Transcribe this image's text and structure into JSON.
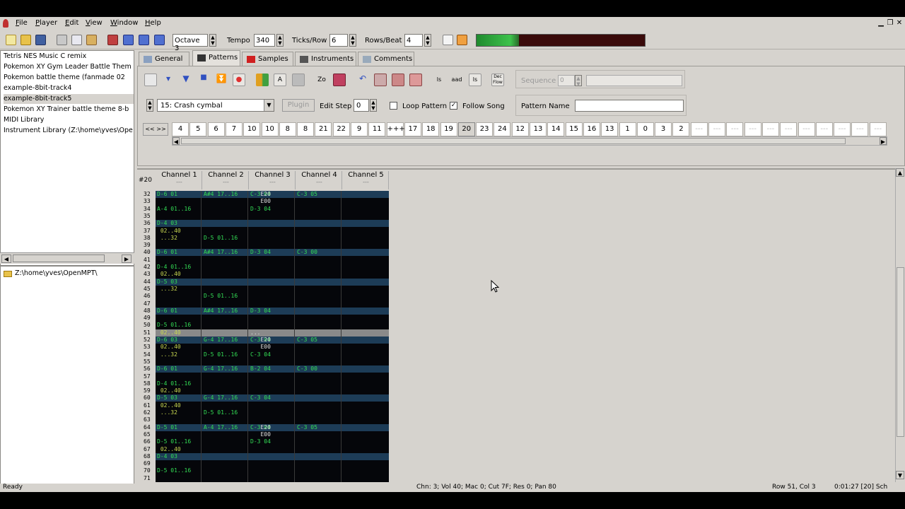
{
  "menubar": {
    "items": [
      "File",
      "Player",
      "Edit",
      "View",
      "Window",
      "Help"
    ],
    "underline": [
      "F",
      "P",
      "E",
      "V",
      "W",
      "H"
    ]
  },
  "toolbar": {
    "octave_label": "Octave 3",
    "tempo_label": "Tempo",
    "tempo_value": "340",
    "ticks_label": "Ticks/Row",
    "ticks_value": "6",
    "rows_label": "Rows/Beat",
    "rows_value": "4",
    "vu_level": 0.25
  },
  "tree": {
    "items": [
      "Tetris NES Music C remix",
      "Pokemon XY Gym Leader Battle Them",
      "Pokemon battle theme (fanmade 02",
      "example-8bit-track4",
      "example-8bit-track5",
      "Pokemon XY Trainer battle theme 8-b",
      "MIDI Library",
      "Instrument Library (Z:\\home\\yves\\Ope"
    ],
    "selected": 4
  },
  "folder": {
    "path": "Z:\\home\\yves\\OpenMPT\\"
  },
  "tabs": [
    "General",
    "Patterns",
    "Samples",
    "Instruments",
    "Comments"
  ],
  "active_tab": 1,
  "pattern_controls": {
    "instrument": "15: Crash cymbal",
    "plugin_label": "Plugin",
    "edit_step_label": "Edit Step",
    "edit_step_value": "0",
    "loop_pattern_label": "Loop Pattern",
    "loop_pattern_checked": false,
    "follow_song_label": "Follow Song",
    "follow_song_checked": true,
    "pattern_name_label": "Pattern Name",
    "sequence_label": "Sequence",
    "sequence_value": "0",
    "order_nav": "<< >>"
  },
  "orders": [
    "4",
    "5",
    "6",
    "7",
    "10",
    "10",
    "8",
    "8",
    "21",
    "22",
    "9",
    "11",
    "+++",
    "17",
    "18",
    "19",
    "20",
    "23",
    "24",
    "12",
    "13",
    "14",
    "15",
    "16",
    "13",
    "1",
    "0",
    "3",
    "2",
    "---",
    "---",
    "---",
    "---",
    "---",
    "---",
    "---",
    "---",
    "---",
    "---",
    "---"
  ],
  "current_order": 16,
  "pattern": {
    "number": "#20",
    "channels": [
      "Channel 1",
      "Channel 2",
      "Channel 3",
      "Channel 4",
      "Channel 5"
    ],
    "channel_dash": "---",
    "rows": [
      "32",
      "33",
      "34",
      "35",
      "36",
      "37",
      "38",
      "39",
      "40",
      "41",
      "42",
      "43",
      "44",
      "45",
      "46",
      "47",
      "48",
      "49",
      "50",
      "51",
      "52",
      "53",
      "54",
      "55",
      "56",
      "57",
      "58",
      "59",
      "60",
      "61",
      "62",
      "63",
      "64",
      "65",
      "66",
      "67",
      "68",
      "69",
      "70",
      "71"
    ],
    "current_row_index": 19,
    "beat_rows": [
      0,
      4,
      8,
      12,
      16,
      20,
      24,
      28,
      32,
      36
    ],
    "cells": [
      {
        "r": 0,
        "c": 0,
        "t": "D-6 01",
        "k": "g"
      },
      {
        "r": 0,
        "c": 1,
        "t": "A#4 17..16",
        "k": "g"
      },
      {
        "r": 0,
        "c": 2,
        "t": "C-3 04",
        "k": "g"
      },
      {
        "r": 0,
        "c": 2,
        "t": "   E20",
        "k": "w"
      },
      {
        "r": 0,
        "c": 3,
        "t": "C-3 05",
        "k": "g"
      },
      {
        "r": 1,
        "c": 2,
        "t": "   E00",
        "k": "w"
      },
      {
        "r": 2,
        "c": 0,
        "t": "A-4 01..16",
        "k": "g"
      },
      {
        "r": 2,
        "c": 2,
        "t": "D-3 04",
        "k": "g"
      },
      {
        "r": 4,
        "c": 0,
        "t": "D-4 03",
        "k": "g"
      },
      {
        "r": 5,
        "c": 0,
        "t": " 02..40",
        "k": "y"
      },
      {
        "r": 6,
        "c": 0,
        "t": " ...32",
        "k": "y"
      },
      {
        "r": 6,
        "c": 1,
        "t": "D-5 01..16",
        "k": "g"
      },
      {
        "r": 8,
        "c": 0,
        "t": "D-6 01",
        "k": "g"
      },
      {
        "r": 8,
        "c": 1,
        "t": "A#4 17..16",
        "k": "g"
      },
      {
        "r": 8,
        "c": 2,
        "t": "D-3 04",
        "k": "g"
      },
      {
        "r": 8,
        "c": 3,
        "t": "C-3 00",
        "k": "g"
      },
      {
        "r": 10,
        "c": 0,
        "t": "D-4 01..16",
        "k": "g"
      },
      {
        "r": 11,
        "c": 0,
        "t": " 02..40",
        "k": "y"
      },
      {
        "r": 12,
        "c": 0,
        "t": "D-5 03",
        "k": "g"
      },
      {
        "r": 13,
        "c": 0,
        "t": " ...32",
        "k": "y"
      },
      {
        "r": 14,
        "c": 1,
        "t": "D-5 01..16",
        "k": "g"
      },
      {
        "r": 16,
        "c": 0,
        "t": "D-6 01",
        "k": "g"
      },
      {
        "r": 16,
        "c": 1,
        "t": "A#4 17..16",
        "k": "g"
      },
      {
        "r": 16,
        "c": 2,
        "t": "D-3 04",
        "k": "g"
      },
      {
        "r": 18,
        "c": 0,
        "t": "D-5 01..16",
        "k": "g"
      },
      {
        "r": 19,
        "c": 0,
        "t": " 02..40",
        "k": "y"
      },
      {
        "r": 19,
        "c": 2,
        "t": "...",
        "k": "w"
      },
      {
        "r": 20,
        "c": 0,
        "t": "D-6 03",
        "k": "g"
      },
      {
        "r": 20,
        "c": 1,
        "t": "G-4 17..16",
        "k": "g"
      },
      {
        "r": 20,
        "c": 2,
        "t": "C-3 04",
        "k": "g"
      },
      {
        "r": 20,
        "c": 2,
        "t": "   E20",
        "k": "w"
      },
      {
        "r": 20,
        "c": 3,
        "t": "C-3 05",
        "k": "g"
      },
      {
        "r": 21,
        "c": 0,
        "t": " 02..40",
        "k": "y"
      },
      {
        "r": 21,
        "c": 2,
        "t": "   E00",
        "k": "w"
      },
      {
        "r": 22,
        "c": 0,
        "t": " ...32",
        "k": "y"
      },
      {
        "r": 22,
        "c": 1,
        "t": "D-5 01..16",
        "k": "g"
      },
      {
        "r": 22,
        "c": 2,
        "t": "C-3 04",
        "k": "g"
      },
      {
        "r": 24,
        "c": 0,
        "t": "D-6 01",
        "k": "g"
      },
      {
        "r": 24,
        "c": 1,
        "t": "G-4 17..16",
        "k": "g"
      },
      {
        "r": 24,
        "c": 2,
        "t": "B-2 04",
        "k": "g"
      },
      {
        "r": 24,
        "c": 3,
        "t": "C-3 00",
        "k": "g"
      },
      {
        "r": 26,
        "c": 0,
        "t": "D-4 01..16",
        "k": "g"
      },
      {
        "r": 27,
        "c": 0,
        "t": " 02..40",
        "k": "y"
      },
      {
        "r": 28,
        "c": 0,
        "t": "D-5 03",
        "k": "g"
      },
      {
        "r": 28,
        "c": 1,
        "t": "G-4 17..16",
        "k": "g"
      },
      {
        "r": 28,
        "c": 2,
        "t": "C-3 04",
        "k": "g"
      },
      {
        "r": 29,
        "c": 0,
        "t": " 02..40",
        "k": "y"
      },
      {
        "r": 30,
        "c": 0,
        "t": " ...32",
        "k": "y"
      },
      {
        "r": 30,
        "c": 1,
        "t": "D-5 01..16",
        "k": "g"
      },
      {
        "r": 32,
        "c": 0,
        "t": "D-5 01",
        "k": "g"
      },
      {
        "r": 32,
        "c": 1,
        "t": "A-4 17..16",
        "k": "g"
      },
      {
        "r": 32,
        "c": 2,
        "t": "C-3 04",
        "k": "g"
      },
      {
        "r": 32,
        "c": 2,
        "t": "   E20",
        "k": "w"
      },
      {
        "r": 32,
        "c": 3,
        "t": "C-3 05",
        "k": "g"
      },
      {
        "r": 33,
        "c": 2,
        "t": "   E00",
        "k": "w"
      },
      {
        "r": 34,
        "c": 0,
        "t": "D-5 01..16",
        "k": "g"
      },
      {
        "r": 34,
        "c": 2,
        "t": "D-3 04",
        "k": "g"
      },
      {
        "r": 35,
        "c": 0,
        "t": " 02..40",
        "k": "y"
      },
      {
        "r": 36,
        "c": 0,
        "t": "D-4 03",
        "k": "g"
      },
      {
        "r": 38,
        "c": 0,
        "t": "D-5 01..16",
        "k": "g"
      }
    ]
  },
  "status": {
    "left": "Ready",
    "middle": "Chn: 3; Vol 40; Mac 0; Cut 7F; Res 0; Pan 80",
    "rowcol": "Row 51, Col 3",
    "time": "0:01:27 [20] Sch"
  },
  "colors": {
    "beat_row": "#1d3c57",
    "note_green": "#33dd55",
    "note_yellow": "#c8d850",
    "panel": "#d6d3ce"
  }
}
